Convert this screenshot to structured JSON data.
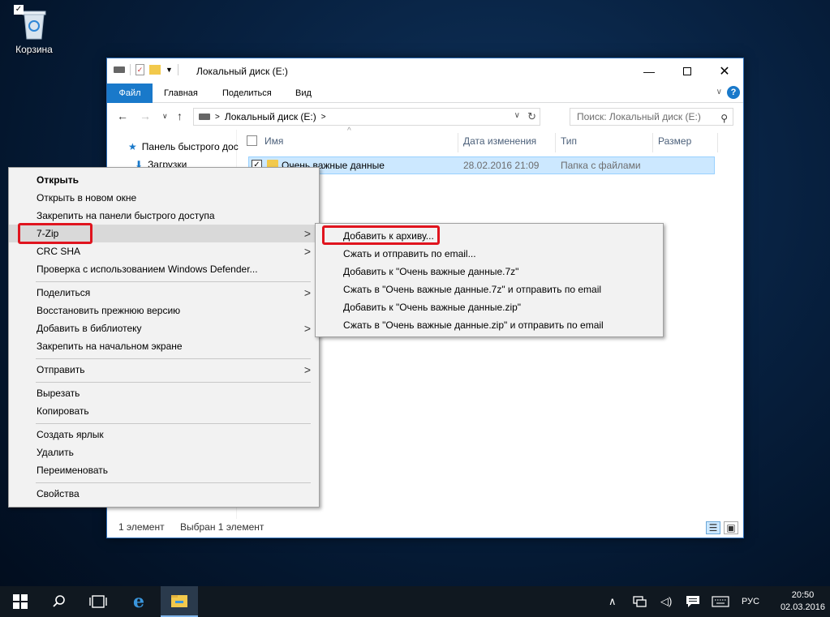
{
  "desktop": {
    "recycle_bin_label": "Корзина"
  },
  "window": {
    "title": "Локальный диск (E:)",
    "ribbon_tabs": [
      "Файл",
      "Главная",
      "Поделиться",
      "Вид"
    ],
    "address": "Локальный диск (E:)",
    "search_placeholder": "Поиск: Локальный диск (E:)",
    "nav_items": [
      "Панель быстрого дос",
      "Загрузки"
    ],
    "columns": [
      "Имя",
      "Дата изменения",
      "Тип",
      "Размер"
    ],
    "rows": [
      {
        "name": "Очень важные данные",
        "date": "28.02.2016 21:09",
        "type": "Папка с файлами",
        "size": ""
      }
    ],
    "status_count": "1 элемент",
    "status_selected": "Выбран 1 элемент"
  },
  "context_menu": {
    "items": {
      "open": "Открыть",
      "open_new_window": "Открыть в новом окне",
      "pin_quick_access": "Закрепить на панели быстрого доступа",
      "seven_zip": "7-Zip",
      "crc_sha": "CRC SHA",
      "defender": "Проверка с использованием Windows Defender...",
      "share": "Поделиться",
      "restore": "Восстановить прежнюю версию",
      "add_library": "Добавить в библиотеку",
      "pin_start": "Закрепить на начальном экране",
      "send_to": "Отправить",
      "cut": "Вырезать",
      "copy": "Копировать",
      "create_shortcut": "Создать ярлык",
      "delete": "Удалить",
      "rename": "Переименовать",
      "properties": "Свойства"
    }
  },
  "submenu_7zip": {
    "items": [
      "Добавить к архиву...",
      "Сжать и отправить по email...",
      "Добавить к \"Очень важные данные.7z\"",
      "Сжать в \"Очень важные данные.7z\" и отправить по email",
      "Добавить к \"Очень важные данные.zip\"",
      "Сжать в \"Очень важные данные.zip\" и отправить по email"
    ]
  },
  "taskbar": {
    "language": "РУС",
    "time": "20:50",
    "date": "02.03.2016"
  },
  "colors": {
    "accent": "#1979ca",
    "highlight_box": "#e0141e",
    "selected_row": "#cce8ff"
  }
}
